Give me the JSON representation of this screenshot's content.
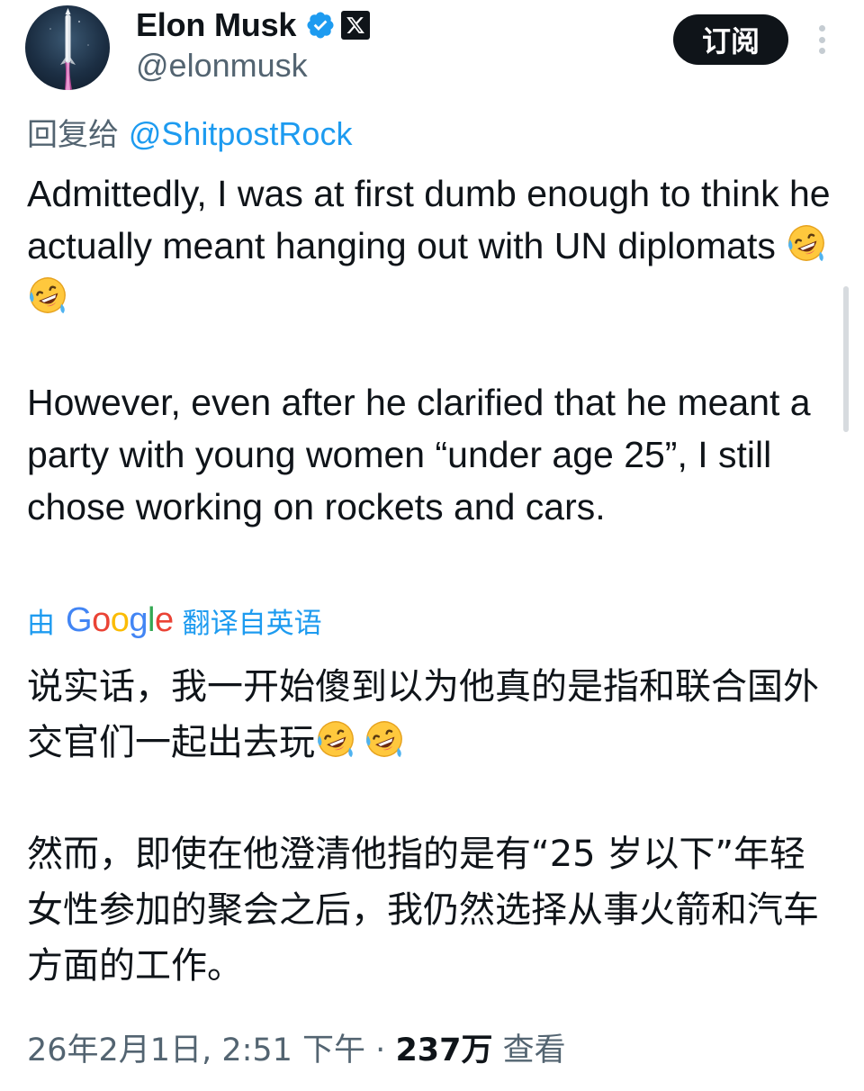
{
  "author": {
    "display_name": "Elon Musk",
    "handle": "@elonmusk",
    "avatar_icon": "rocket-launch-avatar",
    "verified_icon": "verified-badge-icon",
    "affiliation_icon": "x-logo-icon"
  },
  "header": {
    "subscribe_label": "订阅",
    "more_icon": "more-vertical-icon"
  },
  "reply": {
    "prefix": "回复给 ",
    "handle": "@ShitpostRock"
  },
  "tweet": {
    "paragraph_1": "Admittedly, I was at first dumb enough to think he actually meant hanging out with UN diplomats ",
    "paragraph_2": "However, even after he clarified that he meant a party with young women “under age 25”, I still chose working on rockets and cars."
  },
  "translation": {
    "by_prefix": "由",
    "provider_letters": [
      "G",
      "o",
      "o",
      "g",
      "l",
      "e"
    ],
    "provider_colors": [
      "#4285F4",
      "#EA4335",
      "#FBBC05",
      "#4285F4",
      "#34A853",
      "#EA4335"
    ],
    "label": "翻译自英语",
    "paragraph_1": "说实话，我一开始傻到以为他真的是指和联合国外交官们一起出去玩",
    "paragraph_2": "然而，即使在他澄清他指的是有“25 岁以下”年轻女性参加的聚会之后，我仍然选择从事火箭和汽车方面的工作。"
  },
  "emoji": {
    "name": "rolling-on-the-floor-laughing-emoji",
    "count": 2
  },
  "meta": {
    "timestamp": "26年2月1日, 2:51 下午",
    "separator": " · ",
    "views_count": "237万",
    "views_label": " 查看"
  },
  "colors": {
    "accent": "#1d9bf0",
    "text": "#0f1419",
    "secondary": "#536471",
    "verified": "#1d9bf0"
  }
}
